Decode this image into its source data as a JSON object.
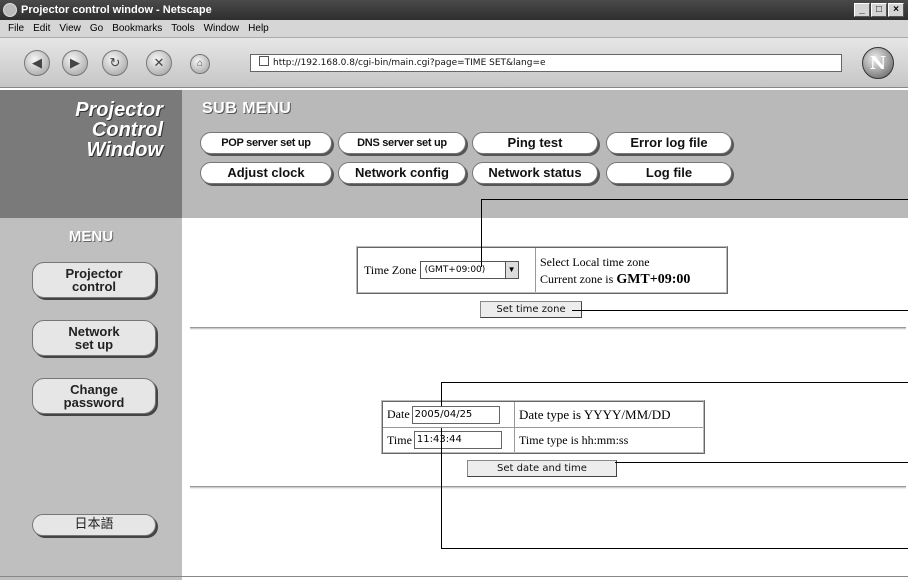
{
  "window": {
    "title": "Projector control window - Netscape",
    "buttons": [
      "_",
      "□",
      "×"
    ]
  },
  "menubar": [
    "File",
    "Edit",
    "View",
    "Go",
    "Bookmarks",
    "Tools",
    "Window",
    "Help"
  ],
  "address": {
    "url": "http://192.168.0.8/cgi-bin/main.cgi?page=TIME SET&lang=e"
  },
  "logo": {
    "line1": "Projector",
    "line2": "Control",
    "line3": "Window"
  },
  "submenu": {
    "title": "SUB MENU",
    "row1": [
      "POP server set up",
      "DNS server set up",
      "Ping test",
      "Error log file"
    ],
    "row2": [
      "Adjust clock",
      "Network config",
      "Network status",
      "Log file"
    ]
  },
  "menu": {
    "title": "MENU",
    "items": [
      {
        "line1": "Projector",
        "line2": "control"
      },
      {
        "line1": "Network",
        "line2": "set up"
      },
      {
        "line1": "Change",
        "line2": "password"
      }
    ],
    "language_button": "日本語"
  },
  "timezone": {
    "label": "Time Zone",
    "selected": "(GMT+09:00)",
    "hint": "Select Local time zone",
    "current_label": "Current zone is",
    "current_value": "GMT+09:00",
    "button": "Set time zone"
  },
  "datetime": {
    "date_label": "Date",
    "date_value": "2005/04/25",
    "date_hint": "Date type is YYYY/MM/DD",
    "time_label": "Time",
    "time_value": "11:43:44",
    "time_hint": "Time type is hh:mm:ss",
    "button": "Set date and time"
  }
}
